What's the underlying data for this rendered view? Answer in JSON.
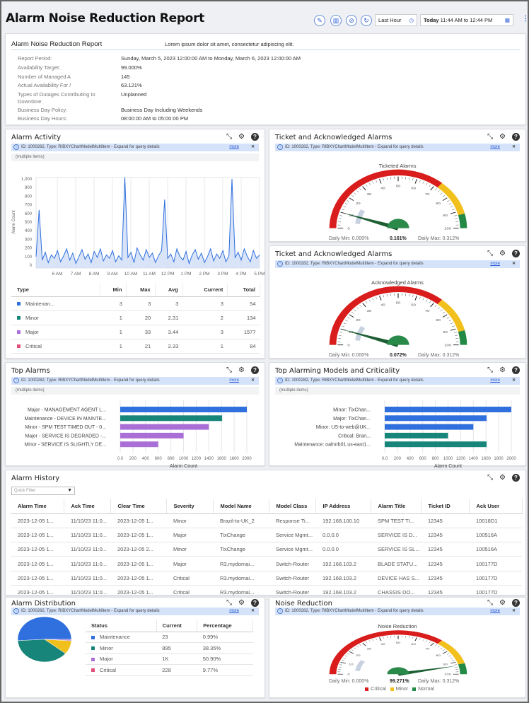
{
  "header": {
    "title": "Alarm Noise Reduction Report",
    "time_range": "Last Hour",
    "date_prefix": "Today",
    "date_range": "11:44 AM to 12:44 PM",
    "icons": [
      "pencil-icon",
      "dashboard-icon",
      "hide-icon",
      "refresh-icon"
    ]
  },
  "report": {
    "title": "Alarm Noise Reduction Report",
    "description": "Lorem ipsum dolor sit amet, consectetur adipiscing elit.",
    "rows": [
      {
        "label": "Report Period:",
        "value": "Sunday, March 5, 2023 12:00:00 AM to Monday, March 6, 2023 12:00:00 AM"
      },
      {
        "label": "Availability Target:",
        "value": "99.000%"
      },
      {
        "label": "Number of Managed A",
        "value": "145"
      },
      {
        "label": "Actual Availability For /",
        "value": "63.121%"
      },
      {
        "label": "Types of Outages Contributing to Downtime:",
        "value": "Unplanned"
      },
      {
        "label": "Business Day Policy:",
        "value": "Business Day Including Weekends"
      },
      {
        "label": "Business Day Hours:",
        "value": "08:00:00 AM to 05:00:00 PM"
      }
    ]
  },
  "info_bar": {
    "text": "ID: 1000282, Type: RIBXYChartModelMultiItem - Expand for query details",
    "more": "more",
    "multi": "(mutliple items)"
  },
  "alarm_activity": {
    "title": "Alarm Activity",
    "table": {
      "headers": [
        "Type",
        "Min",
        "Max",
        "Avg",
        "Current",
        "Total"
      ],
      "rows": [
        {
          "type": "Maintenan...",
          "color": "#2f6fde",
          "min": "3",
          "max": "3",
          "avg": "3",
          "current": "3",
          "total": "54"
        },
        {
          "type": "Minor",
          "color": "#17857a",
          "min": "1",
          "max": "20",
          "avg": "2.31",
          "current": "2",
          "total": "134"
        },
        {
          "type": "Major",
          "color": "#a96fd6",
          "min": "1",
          "max": "33",
          "avg": "3.44",
          "current": "3",
          "total": "1577"
        },
        {
          "type": "Critical",
          "color": "#e0507a",
          "min": "1",
          "max": "21",
          "avg": "2.33",
          "current": "1",
          "total": "84"
        }
      ]
    }
  },
  "ticket1": {
    "title": "Ticket and Acknowledged Alarms",
    "gauge_title": "Ticketed Alarms",
    "value": "0.161%",
    "needle_value": 10,
    "daily_min": "Daily Min: 0.000%",
    "daily_max": "Daily Max: 0.312%"
  },
  "ticket2": {
    "title": "Ticket and Acknowledged Alarms",
    "gauge_title": "Acknowledged Alarms",
    "value": "0.072%",
    "needle_value": 10,
    "daily_min": "Daily Min: 0.000%",
    "daily_max": "Daily Max: 0.312%"
  },
  "top_alarms": {
    "title": "Top Alarms"
  },
  "top_models": {
    "title": "Top Alarming Models and Criticality"
  },
  "history": {
    "title": "Alarm History",
    "filter_placeholder": "Quick Filter",
    "headers": [
      "Alarm Time",
      "Ack Time",
      "Clear Time",
      "Severity",
      "Model Name",
      "Model Class",
      "IP Address",
      "Alarm Title",
      "Ticket ID",
      "Ack User"
    ],
    "rows": [
      [
        "2023-12-05 1...",
        "11/10/23 11:0...",
        "2023-12-05 1...",
        "Minor",
        "Brazil-to-UK_2",
        "Response Ti...",
        "192.168.100.10",
        "SPM TEST TI...",
        "12345",
        "10018D1"
      ],
      [
        "2023-12-05 1...",
        "11/10/23 11:0...",
        "2023-12-05 1...",
        "Major",
        "TixChange",
        "Service Mgmt...",
        "0.0.0.0",
        "SERVICE IS D...",
        "12345",
        "100516A"
      ],
      [
        "2023-12-05 1...",
        "11/10/23 11:0...",
        "2023-12-05 2...",
        "Minor",
        "TixChange",
        "Service Mgmt...",
        "0.0.0.0",
        "SERVICE IS SL...",
        "12345",
        "100516A"
      ],
      [
        "2023-12-05 1...",
        "11/10/23 11:0...",
        "2023-12-05 1...",
        "Major",
        "R3.mydomai...",
        "Switch-Router",
        "192.168.103.2",
        "BLADE STATU...",
        "12345",
        "100177D"
      ],
      [
        "2023-12-05 1...",
        "11/10/23 11:0...",
        "2023-12-05 1...",
        "Critical",
        "R3.mydomai...",
        "Switch-Router",
        "192.168.103.2",
        "DEVICE HAS S...",
        "12345",
        "100177D"
      ],
      [
        "2023-12-05 1...",
        "11/10/23 11:0...",
        "2023-12-05 1...",
        "Critical",
        "R3.mydomai...",
        "Switch-Router",
        "192.168.103.2",
        "CHASSIS DO...",
        "12345",
        "100177D"
      ]
    ]
  },
  "distribution": {
    "title": "Alarm Distribution",
    "headers": [
      "Status",
      "Current",
      "Percentage"
    ],
    "rows": [
      {
        "status": "Maintenance",
        "color": "#2f6fde",
        "current": "23",
        "pct": "0.99%"
      },
      {
        "status": "Minor",
        "color": "#17857a",
        "current": "895",
        "pct": "38.35%"
      },
      {
        "status": "Major",
        "color": "#a96fd6",
        "current": "1K",
        "pct": "50.90%"
      },
      {
        "status": "Critical",
        "color": "#e0507a",
        "current": "228",
        "pct": "9.77%"
      }
    ]
  },
  "noise": {
    "title": "Noise Reduction",
    "gauge_title": "Noise Reduction",
    "value": "99.271%",
    "needle_value": 93,
    "daily_min": "Daily Min: 0.000%",
    "daily_max": "Daily Max: 0.312%",
    "legend": [
      {
        "label": "Critical",
        "color": "#d91c1c"
      },
      {
        "label": "Minor",
        "color": "#f2c01c"
      },
      {
        "label": "Normal",
        "color": "#238a45"
      }
    ]
  },
  "gauge_bands": [
    {
      "from": 0,
      "to": 72,
      "color": "#d91c1c"
    },
    {
      "from": 72,
      "to": 92,
      "color": "#f2c01c"
    },
    {
      "from": 92,
      "to": 100,
      "color": "#238a45"
    }
  ],
  "chart_data": [
    {
      "type": "area",
      "ylabel": "Alarm Count",
      "ylim": [
        0,
        1000
      ],
      "yticks": [
        "0",
        "100",
        "200",
        "300",
        "400",
        "500",
        "600",
        "700",
        "800",
        "900",
        "1,000"
      ],
      "xticks": [
        "6 AM",
        "7 AM",
        "8 AM",
        "9 AM",
        "10 AM",
        "11 AM",
        "12 PM",
        "1 PM",
        "2 PM",
        "3 PM",
        "4 PM",
        "5 PM"
      ],
      "x_start": "4:50 AM",
      "x_step_minutes": 10,
      "grid": true,
      "color": "#2f6fde",
      "values": [
        100,
        640,
        60,
        150,
        30,
        120,
        80,
        170,
        40,
        110,
        190,
        60,
        140,
        20,
        100,
        180,
        70,
        130,
        30,
        160,
        90,
        190,
        50,
        120,
        80,
        170,
        40,
        110,
        60,
        1020,
        90,
        150,
        30,
        200,
        120,
        60,
        180,
        90,
        140,
        30,
        110,
        170,
        760,
        80,
        130,
        40,
        190,
        100,
        60,
        160,
        20,
        120,
        180,
        70,
        140,
        30,
        100,
        190,
        50,
        130,
        80,
        170,
        40,
        110,
        1000,
        90,
        150,
        60,
        190,
        100,
        40,
        170,
        80,
        120
      ]
    },
    {
      "type": "bar",
      "orientation": "horizontal",
      "xlabel": "Alarm Count",
      "xlim": [
        0,
        2000
      ],
      "xticks": [
        "0.0",
        "200",
        "400",
        "600",
        "800",
        "1000",
        "1200",
        "1400",
        "1600",
        "1800",
        "2000"
      ],
      "categories": [
        "Major - MANAGEMENT AGENT L...",
        "Maintenance - DEVICE IN MAINTE...",
        "Minor - SPM TEST TIMED OUT - 0...",
        "Major - SERVICE IS DEGRADED -...",
        "Minor - SERVICE IS SLIGHTLY DE..."
      ],
      "values": [
        2000,
        1610,
        1400,
        1000,
        600
      ],
      "colors": [
        "#2f6fde",
        "#17857a",
        "#a96fd6",
        "#a96fd6",
        "#a96fd6"
      ]
    },
    {
      "type": "bar",
      "orientation": "horizontal",
      "xlabel": "Alarm Count",
      "xlim": [
        0,
        2000
      ],
      "xticks": [
        "0.0",
        "200",
        "400",
        "600",
        "800",
        "1000",
        "1200",
        "1400",
        "1600",
        "1800",
        "2000"
      ],
      "categories": [
        "Minor: TixChan...",
        "Major: TixChan...",
        "Minor: US-to-web@UK...",
        "Critical: Bran...",
        "Maintenance: oalmrb01.us-east1..."
      ],
      "values": [
        2000,
        1610,
        1400,
        1000,
        1610
      ],
      "colors": [
        "#2f6fde",
        "#2f6fde",
        "#2f6fde",
        "#17857a",
        "#17857a"
      ]
    },
    {
      "type": "pie",
      "categories": [
        "Major",
        "Minor",
        "Critical",
        "Maintenance"
      ],
      "values": [
        50.9,
        38.35,
        9.77,
        0.99
      ],
      "colors": [
        "#2f6fde",
        "#17857a",
        "#f2c01c",
        "#a96fd6"
      ]
    }
  ]
}
